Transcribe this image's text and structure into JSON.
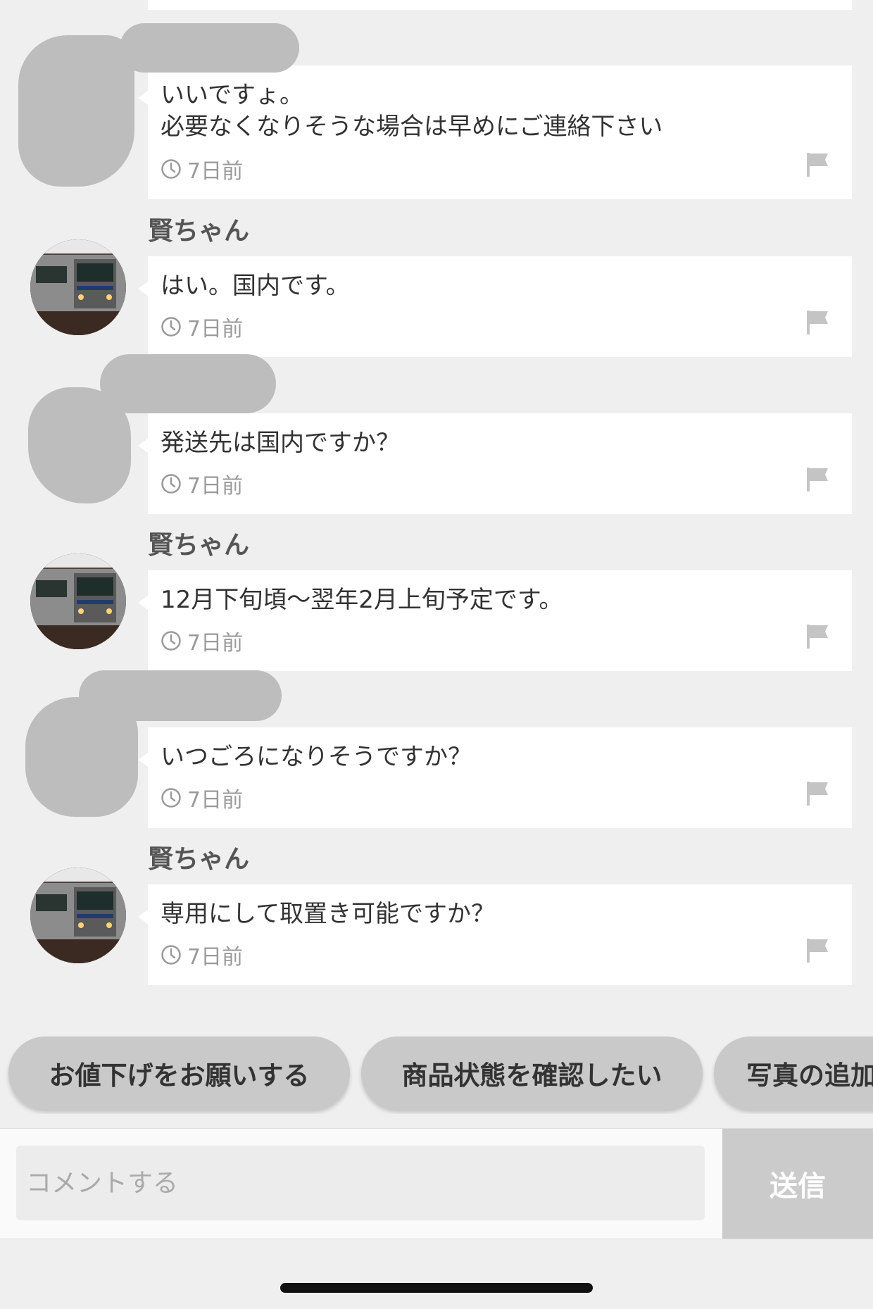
{
  "comments": [
    {
      "author": "",
      "is_redacted_user": true,
      "message": "いいですょ。\n必要なくなりそうな場合は早めにご連絡下さい",
      "time": "7日前"
    },
    {
      "author": "賢ちゃん",
      "is_redacted_user": false,
      "message": "はい。国内です。",
      "time": "7日前"
    },
    {
      "author": "",
      "is_redacted_user": true,
      "message": "発送先は国内ですか？",
      "time": "7日前"
    },
    {
      "author": "賢ちゃん",
      "is_redacted_user": false,
      "message": "12月下旬頃〜翌年2月上旬予定です。",
      "time": "7日前"
    },
    {
      "author": "",
      "is_redacted_user": true,
      "message": "いつごろになりそうですか？",
      "time": "7日前"
    },
    {
      "author": "賢ちゃん",
      "is_redacted_user": false,
      "message": "専用にして取置き可能ですか？",
      "time": "7日前"
    }
  ],
  "quick_replies": [
    "お値下げをお願いする",
    "商品状態を確認したい",
    "写真の追加"
  ],
  "composer": {
    "placeholder": "コメントする",
    "send_label": "送信"
  },
  "colors": {
    "background": "#efefef",
    "bubble": "#ffffff",
    "chip": "#c9c9c9",
    "send_button": "#cbcbcb",
    "redaction": "#bdbdbd"
  }
}
